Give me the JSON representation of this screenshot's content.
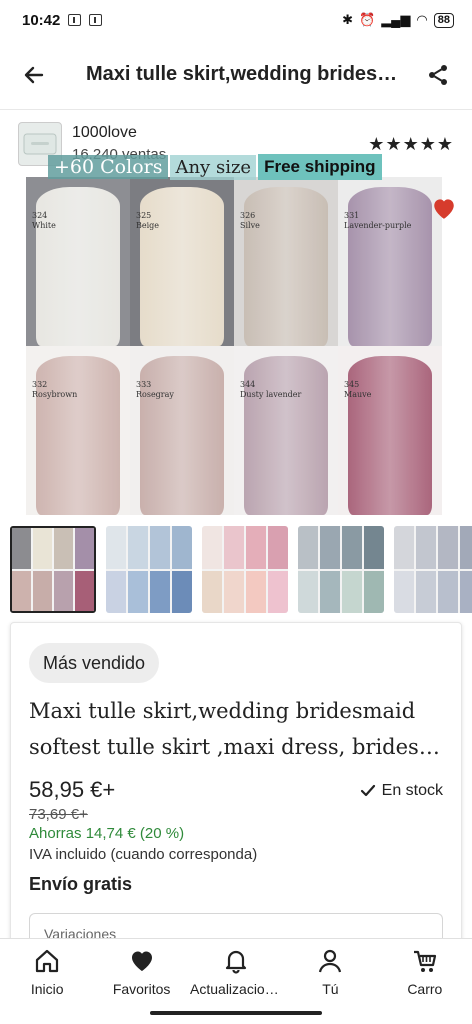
{
  "status_bar": {
    "time": "10:42",
    "battery": "88"
  },
  "header": {
    "title": "Maxi tulle skirt,wedding bridesmaid softest tulle skirt ,maxi dress, bridesmaid dress"
  },
  "shop": {
    "name": "1000love",
    "sales": "16.240 ventas",
    "rating_stars": 5
  },
  "main_image": {
    "skirts": [
      {
        "code": "324",
        "name": "White",
        "color": "#ecebe6",
        "bg": "#8d8e93"
      },
      {
        "code": "325",
        "name": "Beige",
        "color": "#ece2cf",
        "bg": "#7c7d82"
      },
      {
        "code": "326",
        "name": "Silve",
        "color": "#c8bdb3",
        "bg": "#d8d6d4"
      },
      {
        "code": "331",
        "name": "Lavender-purple",
        "color": "#a48fa9",
        "bg": "#ececec"
      },
      {
        "code": "332",
        "name": "Rosybrown",
        "color": "#cdb2ad",
        "bg": "#f3f1ef"
      },
      {
        "code": "333",
        "name": "Rosegray",
        "color": "#c7ada9",
        "bg": "#f1efee"
      },
      {
        "code": "344",
        "name": "Dusty lavender",
        "color": "#b8a1ad",
        "bg": "#f2f0f0"
      },
      {
        "code": "345",
        "name": "Mauve",
        "color": "#a75f77",
        "bg": "#f3efef"
      }
    ],
    "overlay_colors": "+60 Colors",
    "overlay_size": "Any size",
    "overlay_shipping": "Free shipping"
  },
  "thumbnails": [
    {
      "colors": [
        "#8c8c90",
        "#e9e4d6",
        "#c9bfb5",
        "#a48fa9",
        "#cdb2ad",
        "#c7ada9",
        "#b8a1ad",
        "#a75f77"
      ]
    },
    {
      "colors": [
        "#dfe5ea",
        "#c9d6e2",
        "#b2c4d8",
        "#9fb6cf",
        "#c9d2e3",
        "#a9bfd9",
        "#7e9cc4",
        "#6c8cb8"
      ]
    },
    {
      "colors": [
        "#f0e5e2",
        "#eac5cc",
        "#e4aeb9",
        "#d9a0b0",
        "#e9d7c8",
        "#f0d6cc",
        "#f3c9c1",
        "#eec2cf"
      ]
    },
    {
      "colors": [
        "#b9c0c6",
        "#9aa7b1",
        "#8a9aa3",
        "#748690",
        "#cfd9da",
        "#a5b7bc",
        "#c5d6cf",
        "#9fb8b2"
      ]
    },
    {
      "colors": [
        "#d4d6db",
        "#c2c6cf",
        "#b3b7c3",
        "#a2a9b8",
        "#d9dce3",
        "#c7ccd6",
        "#b8bfcd",
        "#a9b1c3"
      ]
    }
  ],
  "product": {
    "badge": "Más vendido",
    "title_line1": "Maxi tulle skirt,wedding bridesmaid",
    "title_line2": "softest tulle skirt ,maxi dress, bridesmaid dress",
    "price": "58,95 €+",
    "stock": "En stock",
    "old_price": "73,69 €+",
    "savings": "Ahorras 14,74 € (20 %)",
    "vat": "IVA incluido (cuando corresponda)",
    "shipping": "Envío gratis",
    "variation_label": "Variaciones"
  },
  "nav": [
    {
      "label": "Inicio",
      "icon": "home-icon"
    },
    {
      "label": "Favoritos",
      "icon": "heart-icon"
    },
    {
      "label": "Actualizaciones",
      "icon": "bell-icon"
    },
    {
      "label": "Tú",
      "icon": "user-icon"
    },
    {
      "label": "Carro",
      "icon": "cart-icon"
    }
  ],
  "colors": {
    "favorite_heart": "#d63b2c",
    "savings_green": "#2f8a3a",
    "free_shipping_teal": "#6ec2bd"
  }
}
